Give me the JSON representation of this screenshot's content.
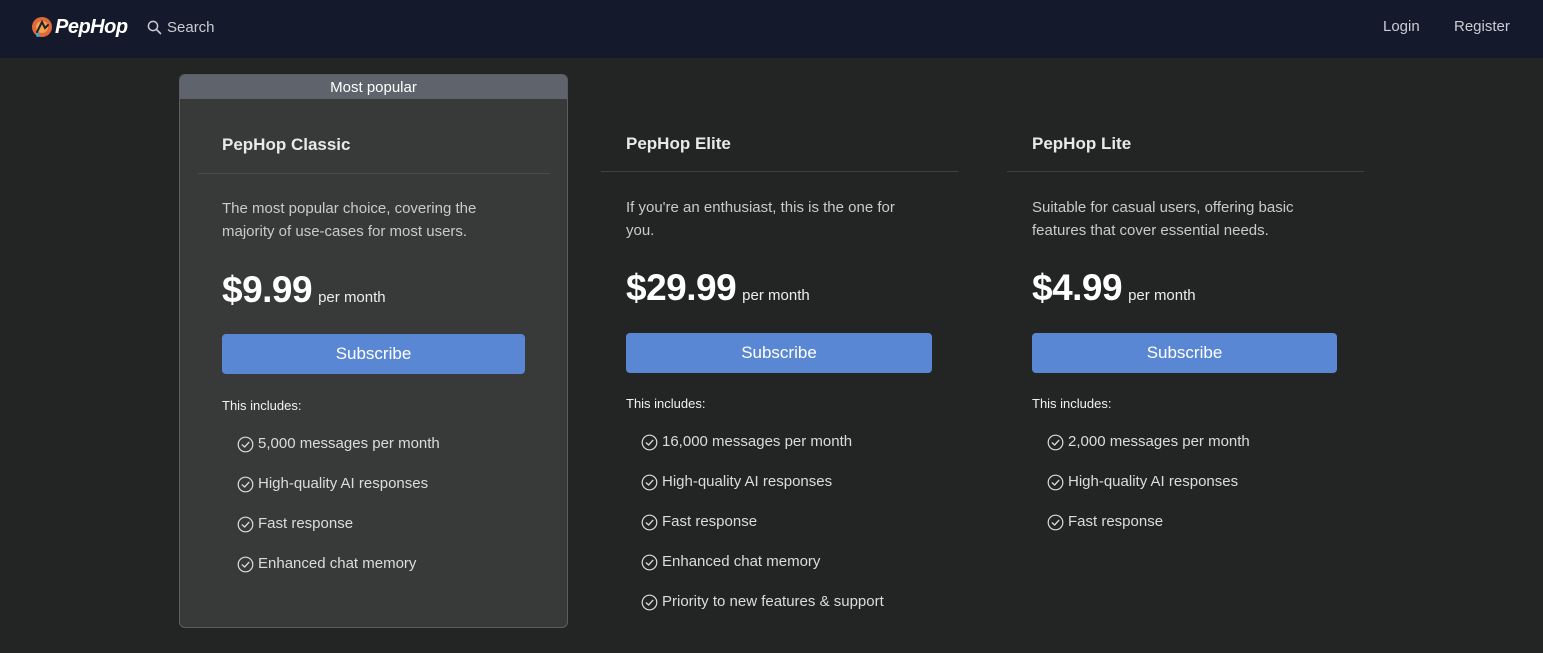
{
  "navbar": {
    "brand": "PepHop",
    "search_label": "Search",
    "login_label": "Login",
    "register_label": "Register"
  },
  "plans": [
    {
      "badge": "Most popular",
      "name": "PepHop Classic",
      "description": "The most popular choice, covering the majority of use-cases for most users.",
      "price": "$9.99",
      "period": "per month",
      "button_label": "Subscribe",
      "includes_label": "This includes:",
      "features": [
        "5,000 messages per month",
        "High-quality AI responses",
        "Fast response",
        "Enhanced chat memory"
      ]
    },
    {
      "name": "PepHop Elite",
      "description": "If you're an enthusiast, this is the one for you.",
      "price": "$29.99",
      "period": "per month",
      "button_label": "Subscribe",
      "includes_label": "This includes:",
      "features": [
        "16,000 messages per month",
        "High-quality AI responses",
        "Fast response",
        "Enhanced chat memory",
        "Priority to new features & support"
      ]
    },
    {
      "name": "PepHop Lite",
      "description": "Suitable for casual users, offering basic features that cover essential needs.",
      "price": "$4.99",
      "period": "per month",
      "button_label": "Subscribe",
      "includes_label": "This includes:",
      "features": [
        "2,000 messages per month",
        "High-quality AI responses",
        "Fast response"
      ]
    }
  ],
  "icons": {
    "brand": "pephop-logo-icon",
    "search": "search-icon",
    "feature": "check-circle-icon"
  },
  "colors": {
    "navbar_bg": "#141a2b",
    "page_bg": "#232524",
    "featured_card_bg": "#383a39",
    "badge_bg": "#5f636c",
    "button_bg": "#5a87d4"
  }
}
